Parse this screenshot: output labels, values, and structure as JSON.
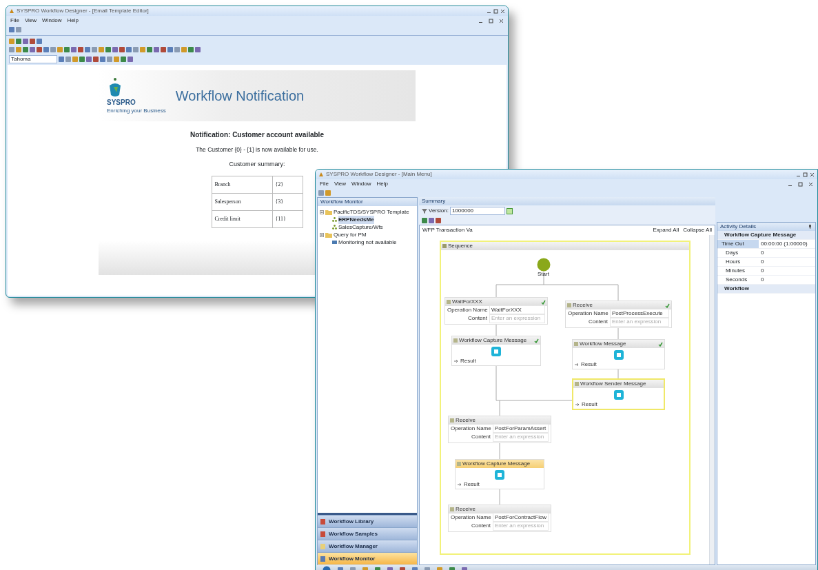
{
  "editor_window": {
    "title": "SYSPRO Workflow Designer - [Email Template Editor]",
    "menu": [
      "File",
      "View",
      "Window",
      "Help"
    ],
    "font_field": "Tahoma",
    "document": {
      "brand": "SYSPRO",
      "tagline": "Enriching your Business",
      "heading": "Workflow Notification",
      "subject": "Notification: Customer account available",
      "message": "The Customer {0} - {1} is now available for use.",
      "summary_label": "Customer summary:",
      "summary_rows": [
        {
          "label": "Branch",
          "value": "{2}"
        },
        {
          "label": "Salesperson",
          "value": "{3}"
        },
        {
          "label": "Credit limit",
          "value": "{11}"
        }
      ]
    }
  },
  "designer_window": {
    "title": "SYSPRO Workflow Designer - [Main Menu]",
    "menu": [
      "File",
      "View",
      "Window",
      "Help"
    ],
    "monitor_panel": {
      "title": "Workflow Monitor",
      "tree": [
        {
          "label": "PacificTDS/SYSPRO Template",
          "expanded": true,
          "children": [
            {
              "label": "ERPNeedsMe",
              "selected": true
            },
            {
              "label": "SalesCapture/Wfs",
              "selected": false
            }
          ]
        },
        {
          "label": "Query for PM",
          "expanded": true,
          "children": [
            {
              "label": "Monitoring not available",
              "selected": false
            }
          ]
        }
      ],
      "nav": [
        {
          "label": "Workflow Library",
          "selected": false
        },
        {
          "label": "Workflow Samples",
          "selected": false
        },
        {
          "label": "Workflow Manager",
          "selected": false
        },
        {
          "label": "Workflow Monitor",
          "selected": true
        }
      ]
    },
    "summary_panel": {
      "title": "Summary",
      "version_label": "Version:",
      "version_value": "1000000",
      "design_title": "WFP Transaction Va",
      "expand_all": "Expand All",
      "collapse_all": "Collapse All",
      "diagram": {
        "sequence": "Sequence",
        "start": "Start",
        "activities": [
          {
            "kind": "receive",
            "title": "WaitForXXX",
            "operation_label": "Operation Name",
            "operation": "WaitForXXX",
            "content_label": "Content",
            "content": "Enter an expression",
            "valid": true
          },
          {
            "kind": "message",
            "title": "Workflow Capture Message",
            "result": "Result",
            "selected": false,
            "active": false,
            "valid": true
          },
          {
            "kind": "receive",
            "title": "Receive",
            "operation_label": "Operation Name",
            "operation": "PostProcessExecute",
            "content_label": "Content",
            "content": "Enter an expression",
            "valid": true
          },
          {
            "kind": "message",
            "title": "Workflow Message",
            "result": "Result",
            "selected": false,
            "active": false,
            "valid": true
          },
          {
            "kind": "message",
            "title": "Workflow Sender Message",
            "result": "Result",
            "selected": true,
            "active": false,
            "valid": false
          },
          {
            "kind": "receive",
            "title": "Receive",
            "operation_label": "Operation Name",
            "operation": "PostForParamAssert",
            "content_label": "Content",
            "content": "Enter an expression",
            "valid": false
          },
          {
            "kind": "message",
            "title": "Workflow Capture Message",
            "result": "Result",
            "selected": false,
            "active": true,
            "valid": false
          },
          {
            "kind": "receive",
            "title": "Receive",
            "operation_label": "Operation Name",
            "operation": "PostForContractFlow",
            "content_label": "Content",
            "content": "Enter an expression",
            "valid": false
          }
        ]
      }
    },
    "details_panel": {
      "title": "Activity Details",
      "category": "Workflow Capture Message",
      "rows": [
        {
          "label": "Time Out",
          "value": "00:00:00 (1:00000)",
          "selected": true
        },
        {
          "label": "Days",
          "value": "0",
          "selected": false
        },
        {
          "label": "Hours",
          "value": "0",
          "selected": false
        },
        {
          "label": "Minutes",
          "value": "0",
          "selected": false
        },
        {
          "label": "Seconds",
          "value": "0",
          "selected": false
        }
      ],
      "footer_category": "Workflow"
    }
  }
}
